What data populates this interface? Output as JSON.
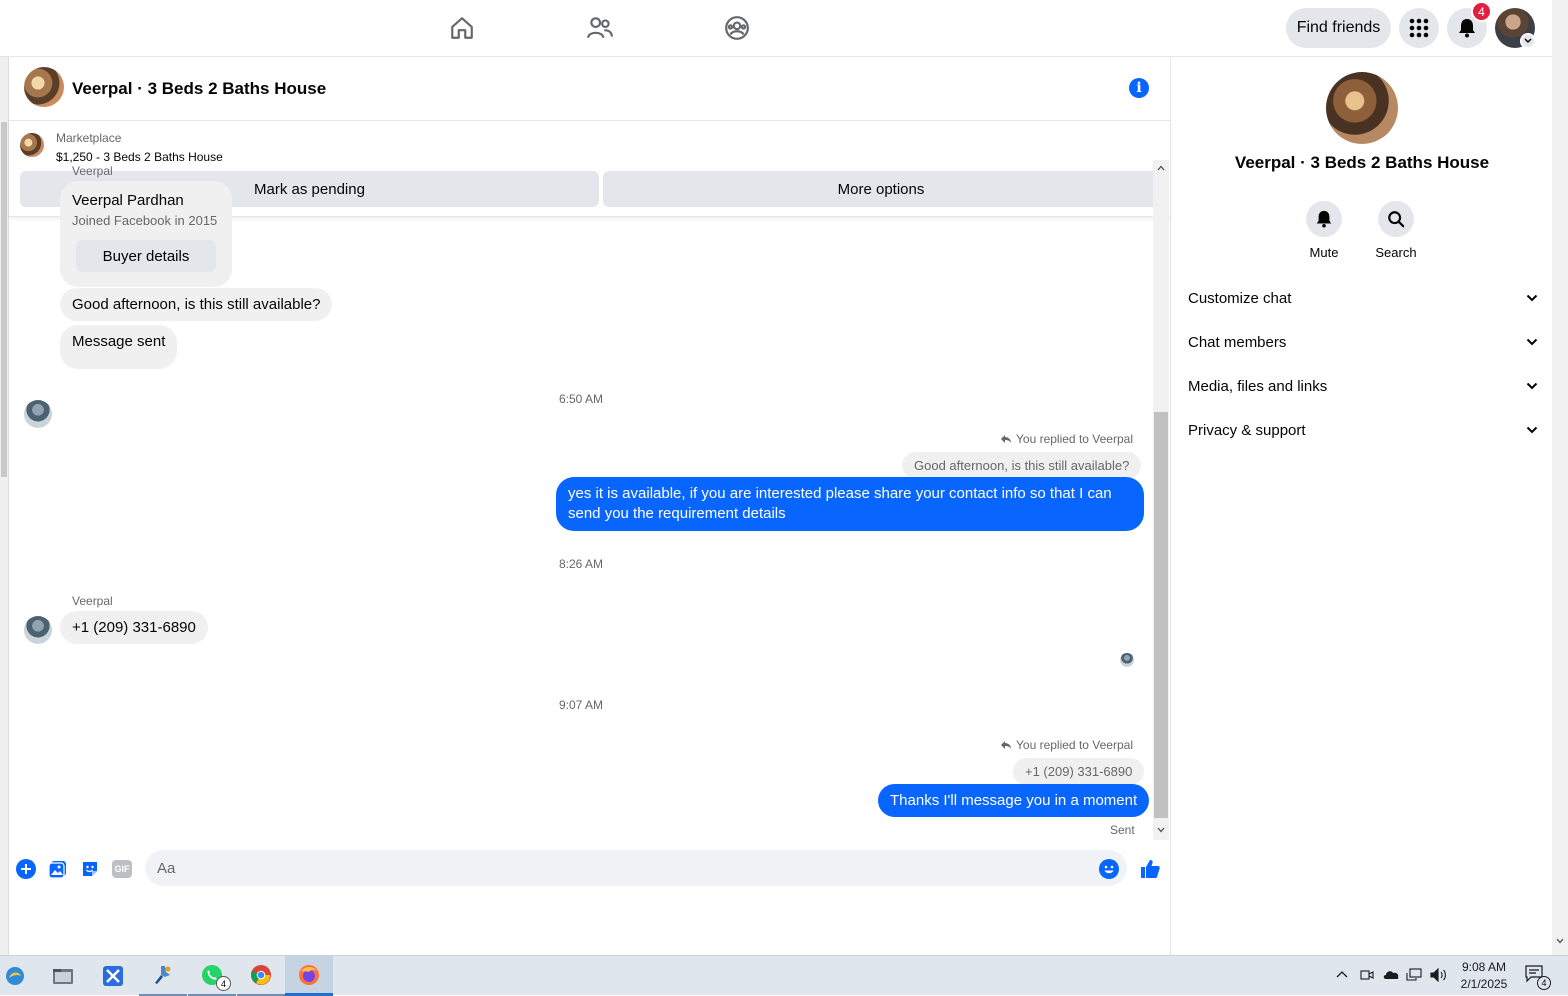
{
  "topbar": {
    "nav_icons": [
      "home-icon",
      "friends-icon",
      "groups-icon"
    ],
    "find_friends_label": "Find friends",
    "notifications_count": "4"
  },
  "chat": {
    "title": "Veerpal · 3 Beds 2 Baths House",
    "marketplace_label": "Marketplace",
    "listing": "$1,250 - 3 Beds 2 Baths House",
    "mark_pending_label": "Mark as pending",
    "more_options_label": "More options",
    "messages": {
      "sender_name": "Veerpal",
      "profile_name": "Veerpal Pardhan",
      "profile_joined": "Joined Facebook in 2015",
      "buyer_details_label": "Buyer details",
      "msg1": "Good afternoon, is this still available?",
      "msg2": "Message sent",
      "time1": "6:50 AM",
      "reply_note1": "You replied to Veerpal",
      "reply_quote1": "Good afternoon, is this still available?",
      "out1": "yes it is available, if you are interested please share your contact info so that I can send you the requirement details",
      "time2": "8:26 AM",
      "sender_name2": "Veerpal",
      "msg3": "+1 (209) 331-6890",
      "time3": "9:07 AM",
      "reply_note2": "You replied to Veerpal",
      "reply_quote2": "+1 (209) 331-6890",
      "out2": "Thanks I'll message you in a moment",
      "status": "Sent"
    },
    "composer": {
      "placeholder": "Aa",
      "gif_label": "GIF"
    }
  },
  "right_panel": {
    "title": "Veerpal · 3 Beds 2 Baths House",
    "mute_label": "Mute",
    "search_label": "Search",
    "sections": [
      "Customize chat",
      "Chat members",
      "Media, files and links",
      "Privacy & support"
    ]
  },
  "taskbar": {
    "time": "9:08 AM",
    "date": "2/1/2025",
    "whatsapp_badge": "4",
    "notification_badge": "4"
  },
  "colors": {
    "accent": "#0866ff",
    "bubble_in": "#f0f0f0",
    "badge": "#e41e3f"
  }
}
